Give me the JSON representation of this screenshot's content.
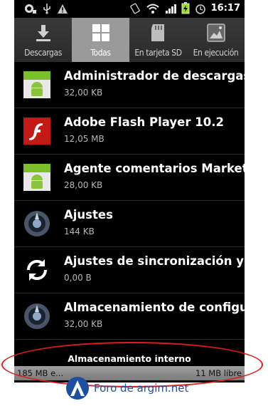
{
  "status_bar": {
    "time": "16:17"
  },
  "tabs": [
    {
      "label": "Descargas",
      "icon": "download-icon",
      "active": false
    },
    {
      "label": "Todas",
      "icon": "grid-icon",
      "active": true
    },
    {
      "label": "En tarjeta SD",
      "icon": "sd-card-icon",
      "active": false
    },
    {
      "label": "En ejecución",
      "icon": "running-apps-icon",
      "active": false
    }
  ],
  "apps": [
    {
      "name": "Administrador de descargas",
      "size": "32,00 KB",
      "icon": "android-default-icon"
    },
    {
      "name": "Adobe Flash Player 10.2",
      "size": "12,05 MB",
      "icon": "flash-icon"
    },
    {
      "name": "Agente comentarios Market",
      "size": "28,00 KB",
      "icon": "android-default-icon"
    },
    {
      "name": "Ajustes",
      "size": "144 KB",
      "icon": "settings-icon"
    },
    {
      "name": "Ajustes de sincronización y d",
      "size": "0,00 B",
      "icon": "sync-icon"
    },
    {
      "name": "Almacenamiento de configur",
      "size": "32,00 KB",
      "icon": "settings-icon"
    }
  ],
  "storage": {
    "title": "Almacenamiento interno",
    "used": "185 MB e...",
    "free": "11 MB libre"
  },
  "watermark": {
    "text": "Foro de argim.net"
  },
  "colors": {
    "active_tab": "#9a9a9a",
    "annotation": "#e01a1a",
    "watermark": "#1d4fa0"
  }
}
